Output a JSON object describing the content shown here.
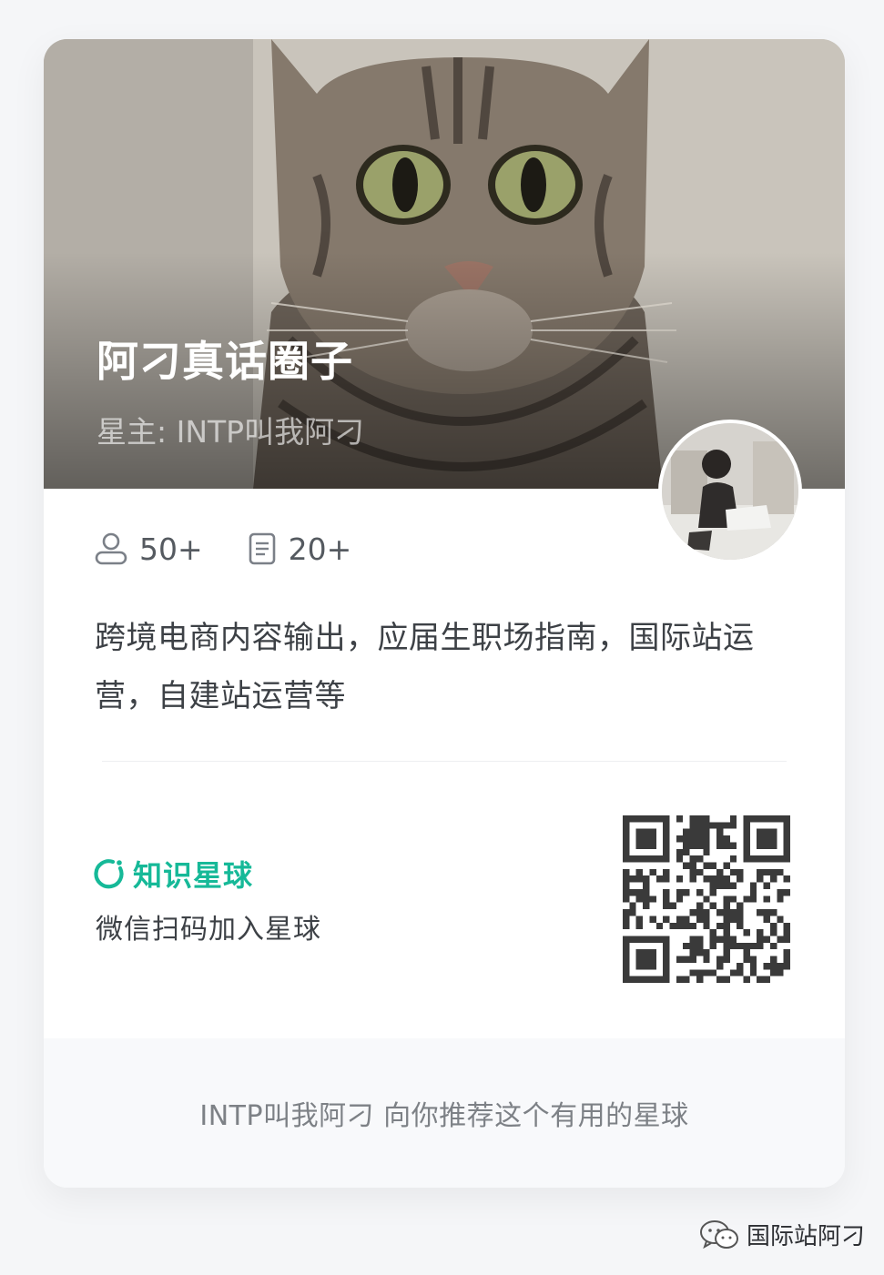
{
  "group": {
    "title": "阿刁真话圈子",
    "owner_line": "星主: INTP叫我阿刁"
  },
  "stats": {
    "members": "50+",
    "topics": "20+"
  },
  "description": "跨境电商内容输出，应届生职场指南，国际站运营，自建站运营等",
  "brand": {
    "name": "知识星球",
    "color": "#16b998"
  },
  "scan_hint": "微信扫码加入星球",
  "footer": {
    "recommend_text": "INTP叫我阿刁 向你推荐这个有用的星球"
  },
  "watermark": {
    "text": "国际站阿刁"
  },
  "icons": {
    "members": "user-icon",
    "topics": "document-icon",
    "brand": "planet-ring-icon",
    "watermark": "wechat-icon"
  }
}
